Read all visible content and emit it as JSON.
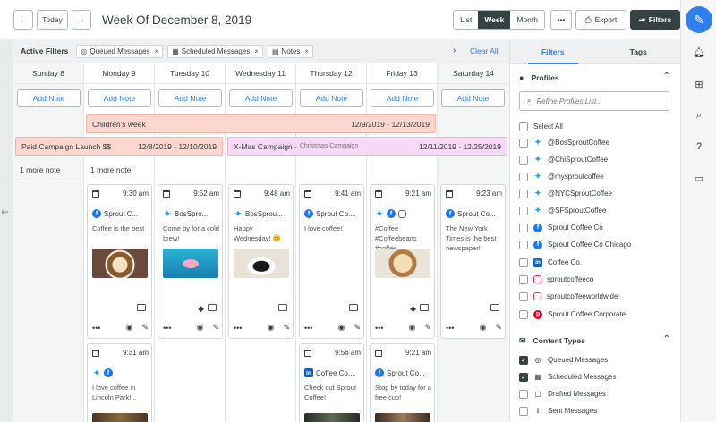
{
  "toolbar": {
    "prev_icon": "arrow-left-icon",
    "today_label": "Today",
    "next_icon": "arrow-right-icon",
    "week_title": "Week Of December 8, 2019",
    "views": [
      "List",
      "Week",
      "Month"
    ],
    "active_view": "Week",
    "more_label": "•••",
    "export_label": "Export",
    "filters_label": "Filters"
  },
  "filter_bar": {
    "label": "Active Filters",
    "chips": [
      "Queued Messages",
      "Scheduled Messages",
      "Notes"
    ],
    "clear_all": "Clear All"
  },
  "days": [
    {
      "name": "Sunday 8",
      "add_note": "Add Note",
      "more": "1 more note"
    },
    {
      "name": "Monday 9",
      "add_note": "Add Note",
      "more": "1 more note"
    },
    {
      "name": "Tuesday 10",
      "add_note": "Add Note",
      "more": ""
    },
    {
      "name": "Wednesday 11",
      "add_note": "Add Note",
      "more": ""
    },
    {
      "name": "Thursday 12",
      "add_note": "Add Note",
      "more": ""
    },
    {
      "name": "Friday 13",
      "add_note": "Add Note",
      "more": ""
    },
    {
      "name": "Saturday 14",
      "add_note": "Add Note",
      "more": ""
    }
  ],
  "campaigns": {
    "children": {
      "title": "Children's week",
      "dates": "12/9/2019 - 12/13/2019"
    },
    "paid": {
      "title": "Paid Campaign Launch $$",
      "dates": "12/8/2019 - 12/10/2019"
    },
    "xmas": {
      "title": "X-Mas Campaign -",
      "subtitle": "Christmas Campaign",
      "dates": "12/11/2019 - 12/25/2019"
    }
  },
  "posts": [
    {
      "day": 1,
      "time": "9:30 am",
      "networks": [
        "facebook"
      ],
      "account": "Sprout C...",
      "text": "Coffee is the best",
      "image": "latte art in cup",
      "comment": true,
      "tag": false
    },
    {
      "day": 2,
      "time": "9:52 am",
      "networks": [
        "twitter"
      ],
      "account": "BosSpro...",
      "text": "Come by for a cold brew!",
      "image": "pool with flamingo float",
      "comment": true,
      "tag": true
    },
    {
      "day": 3,
      "time": "9:48 am",
      "networks": [
        "twitter"
      ],
      "account": "BosSprou...",
      "text": "Happy Wednesday! 😊",
      "image": "coffee cup on saucer",
      "comment": true,
      "tag": false
    },
    {
      "day": 4,
      "time": "9:41 am",
      "networks": [
        "facebook"
      ],
      "account": "Sprout Co...",
      "text": "I love coffee!",
      "image": "",
      "comment": true,
      "tag": false
    },
    {
      "day": 5,
      "time": "9:21 am",
      "networks": [
        "twitter",
        "facebook",
        "instagram"
      ],
      "account": "",
      "text": "#Coffee #Coffeebeans #coffee",
      "image": "smiley face latte",
      "comment": true,
      "tag": true
    },
    {
      "day": 6,
      "time": "9:23 am",
      "networks": [
        "facebook"
      ],
      "account": "Sprout Co...",
      "text": "The New York Times is the best newspaper!",
      "image": "",
      "comment": true,
      "tag": false
    }
  ],
  "posts_lower": [
    {
      "day": 1,
      "time": "9:31 am",
      "networks": [
        "twitter",
        "facebook"
      ],
      "account": "",
      "text": "I love coffee in Lincoln Park!...",
      "image": "coffee shop sign"
    },
    {
      "day": 4,
      "time": "9:56 am",
      "networks": [
        "linkedin"
      ],
      "account": "Coffee Co...",
      "text": "Check out Sprout Coffee!",
      "image": "dark coffee shop"
    },
    {
      "day": 5,
      "time": "9:21 am",
      "networks": [
        "facebook"
      ],
      "account": "Sprout Co...",
      "text": "Stop by today for a free cup!",
      "image": "cafe counter"
    }
  ],
  "card_action_labels": {
    "more": "•••",
    "preview_icon": "eye-icon",
    "edit_icon": "pencil-icon"
  },
  "panel": {
    "tabs": [
      "Filters",
      "Tags"
    ],
    "active_tab": "Filters",
    "profiles_title": "Profiles",
    "refine_placeholder": "Refine Profiles List...",
    "select_all": "Select All",
    "profiles": [
      {
        "network": "twitter",
        "name": "@BosSproutCoffee"
      },
      {
        "network": "twitter",
        "name": "@ChiSproutCoffee"
      },
      {
        "network": "twitter",
        "name": "@mysproutcoffee"
      },
      {
        "network": "twitter",
        "name": "@NYCSproutCoffee"
      },
      {
        "network": "twitter",
        "name": "@SFSproutCoffee"
      },
      {
        "network": "facebook",
        "name": "Sprout Coffee Co"
      },
      {
        "network": "facebook",
        "name": "Sprout Coffee Co Chicago"
      },
      {
        "network": "linkedin",
        "name": "Coffee Co."
      },
      {
        "network": "instagram",
        "name": "sproutcoffeeco"
      },
      {
        "network": "instagram",
        "name": "sproutcoffeeworldwide"
      },
      {
        "network": "pinterest",
        "name": "Sprout Coffee Corporate"
      }
    ],
    "content_types_title": "Content Types",
    "content_types": [
      {
        "label": "Queued Messages",
        "checked": true,
        "icon": "queue-icon"
      },
      {
        "label": "Scheduled Messages",
        "checked": true,
        "icon": "calendar-icon"
      },
      {
        "label": "Drafted Messages",
        "checked": false,
        "icon": "draft-icon"
      },
      {
        "label": "Sent Messages",
        "checked": false,
        "icon": "sent-icon"
      }
    ]
  },
  "colors": {
    "brand_blue": "#2f80ed",
    "dark": "#364141",
    "campaign_red": "#fcd7cf",
    "campaign_pink": "#f7d9f5"
  }
}
